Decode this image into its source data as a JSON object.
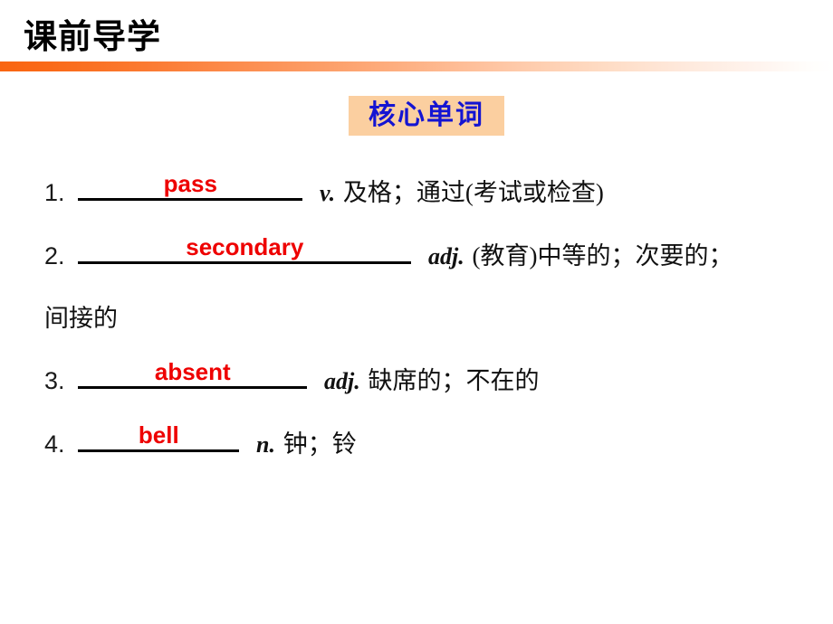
{
  "header": {
    "title": "课前导学",
    "accent_color": "#f96511"
  },
  "section": {
    "label": "核心单词",
    "background_color": "#fbcfa0",
    "text_color": "#1414d2"
  },
  "answer_color": "#ee0000",
  "word_list": [
    {
      "index": "1.",
      "answer": "pass",
      "pos": "v.",
      "definition": "及格；通过(考试或检查)",
      "continuation": ""
    },
    {
      "index": "2.",
      "answer": "secondary",
      "pos": "adj.",
      "definition": "(教育)中等的；次要的；",
      "continuation": "间接的"
    },
    {
      "index": "3.",
      "answer": "absent",
      "pos": "adj.",
      "definition": "缺席的；不在的",
      "continuation": ""
    },
    {
      "index": "4.",
      "answer": "bell",
      "pos": "n.",
      "definition": "钟；铃",
      "continuation": ""
    }
  ]
}
